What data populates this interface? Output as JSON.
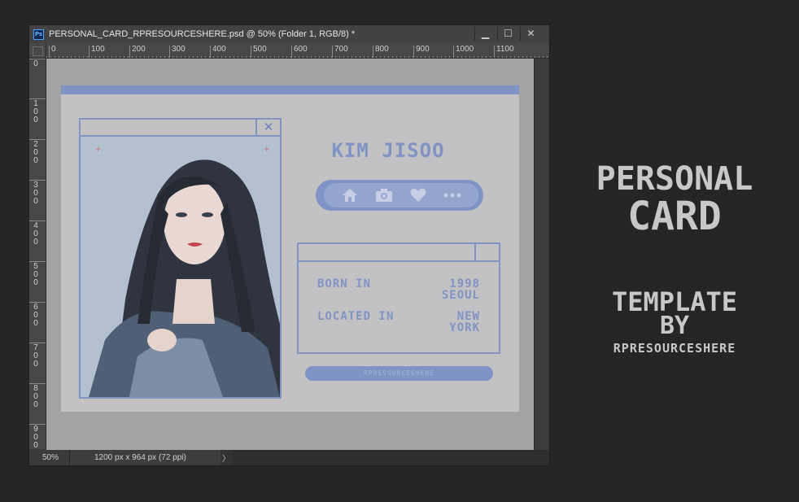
{
  "window": {
    "title": "PERSONAL_CARD_RPRESOURCESHERE.psd @ 50% (Folder 1, RGB/8) *",
    "app_icon": "Ps",
    "minimize_glyph": "▁",
    "maximize_glyph": "☐",
    "close_glyph": "✕"
  },
  "ruler": {
    "horizontal": [
      "0",
      "100",
      "200",
      "300",
      "400",
      "500",
      "600",
      "700",
      "800",
      "900",
      "1000",
      "1100"
    ],
    "vertical": [
      "0",
      "100",
      "200",
      "300",
      "400",
      "500",
      "600",
      "700",
      "800",
      "900"
    ]
  },
  "card": {
    "close_glyph": "✕",
    "name": "KIM JISOO",
    "icons": [
      "home-icon",
      "camera-icon",
      "heart-icon",
      "more-icon"
    ],
    "born_label": "BORN IN",
    "born_year": "1998",
    "born_city": "SEOUL",
    "located_label": "LOCATED IN",
    "located_line1": "NEW",
    "located_line2": "YORK",
    "footer": "RPRESOURCESHERE",
    "accent_color": "#7f93c4"
  },
  "status": {
    "zoom": "50%",
    "doc_info": "1200 px x 964 px (72 ppi)",
    "arrow": "〉"
  },
  "side": {
    "line1": "PERSONAL",
    "line2": "CARD",
    "line3": "TEMPLATE",
    "line4": "BY",
    "line5": "RPRESOURCESHERE"
  }
}
